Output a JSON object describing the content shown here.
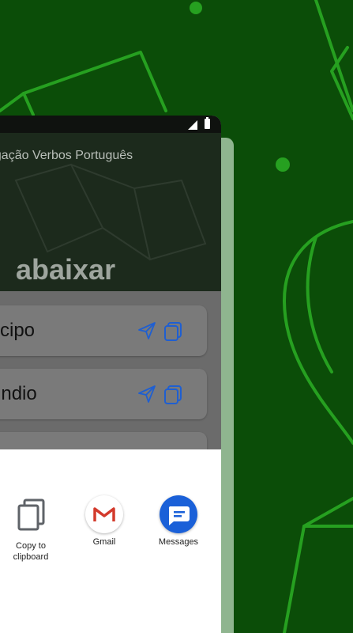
{
  "app": {
    "header_title": "ugação Verbos Português",
    "verb": "abaixar"
  },
  "cards": [
    {
      "label": "ticipo"
    },
    {
      "label": "undio"
    },
    {
      "label": ""
    }
  ],
  "share_sheet": {
    "items": [
      {
        "label": "Copy to\nclipboard",
        "icon": "copy-icon"
      },
      {
        "label": "Gmail",
        "icon": "gmail-icon"
      },
      {
        "label": "Messages",
        "icon": "messages-icon"
      }
    ]
  },
  "colors": {
    "background_green": "#0b4d08",
    "deco_line": "#25a21f",
    "accent_blue": "#1f5fd1",
    "messages_blue": "#1a60d8",
    "gmail_red": "#d33a2c"
  }
}
